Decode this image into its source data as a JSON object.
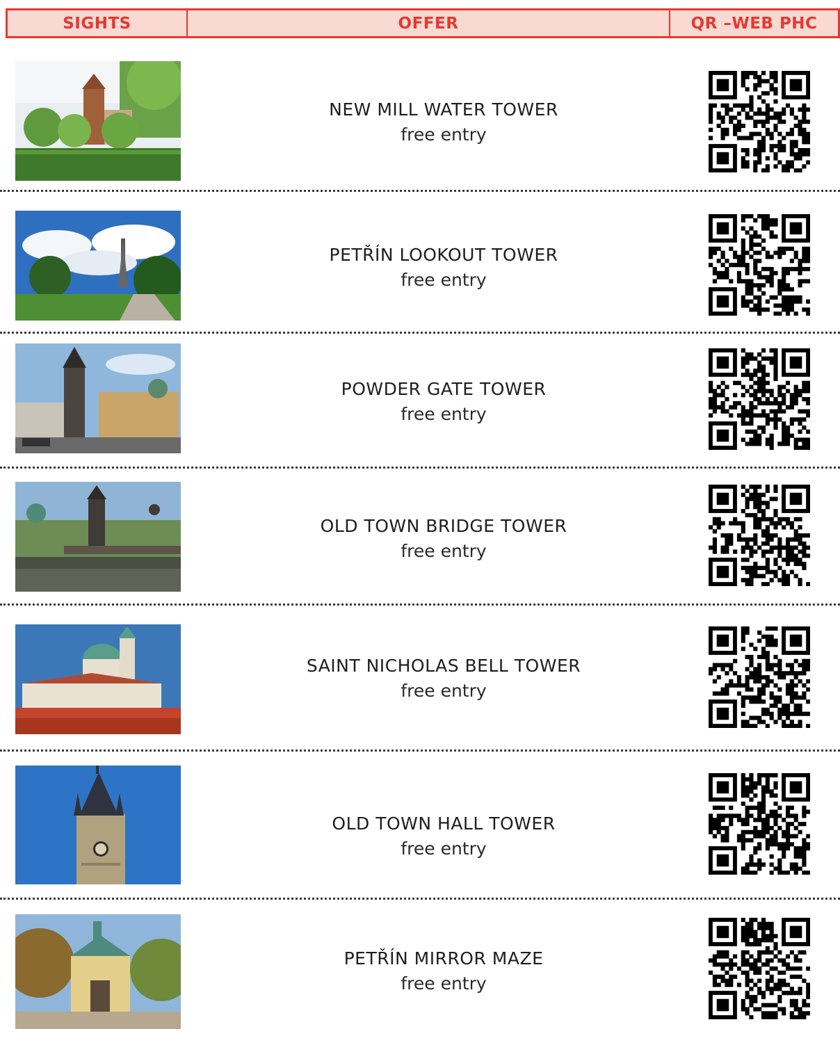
{
  "header": {
    "sights": "SIGHTS",
    "offer": "OFFER",
    "qr": "QR –WEB PHC"
  },
  "colors": {
    "accent": "#e53930",
    "header_bg": "#fbd9d3"
  },
  "rows": [
    {
      "title": "NEW MILL WATER TOWER",
      "offer": "free entry",
      "photo": "new-mill-water-tower-photo"
    },
    {
      "title": "PETŘÍN LOOKOUT TOWER",
      "offer": "free entry",
      "photo": "petrin-lookout-tower-photo"
    },
    {
      "title": "POWDER GATE TOWER",
      "offer": "free entry",
      "photo": "powder-gate-tower-photo"
    },
    {
      "title": "OLD TOWN BRIDGE TOWER",
      "offer": "free entry",
      "photo": "old-town-bridge-tower-photo"
    },
    {
      "title": "SAINT NICHOLAS BELL TOWER",
      "offer": "free entry",
      "photo": "saint-nicholas-bell-tower-photo"
    },
    {
      "title": "OLD TOWN HALL TOWER",
      "offer": "free entry",
      "photo": "old-town-hall-tower-photo"
    },
    {
      "title": "PETŘÍN MIRROR MAZE",
      "offer": "free entry",
      "photo": "petrin-mirror-maze-photo"
    }
  ]
}
